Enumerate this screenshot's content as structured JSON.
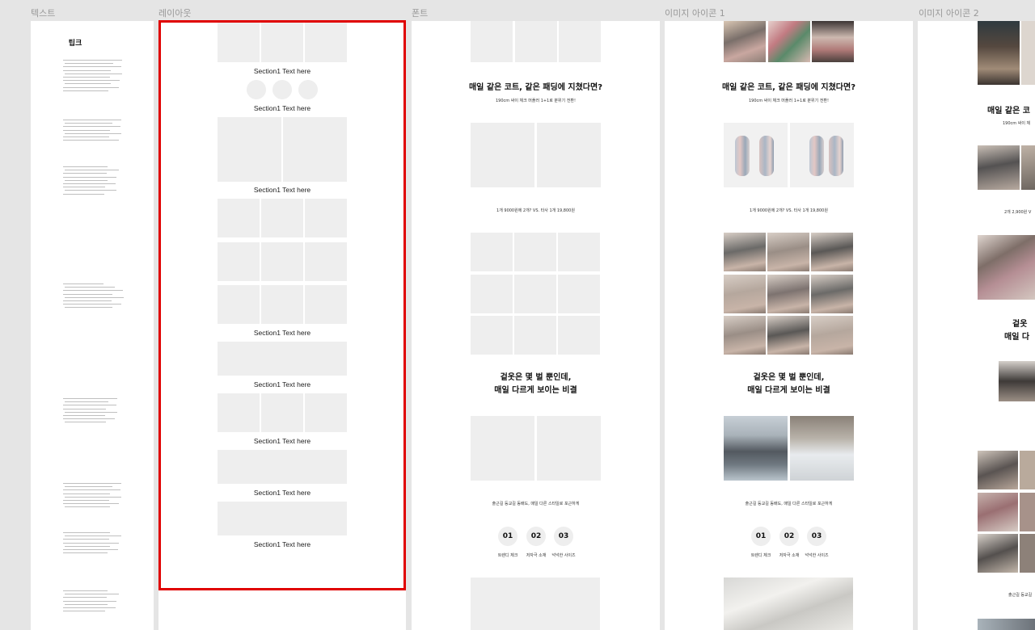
{
  "frames": {
    "text": "텍스트",
    "layout": "레이아웃",
    "font": "폰트",
    "image_icon_1": "이미지 아이콘 1",
    "image_icon_2": "이미지 아이콘 2"
  },
  "text_frame": {
    "title": "팁크"
  },
  "layout_frame": {
    "section_label": "Section1 Text here"
  },
  "font_frame": {
    "heading1": "매일 같은 코트, 같은 패딩에 지쳤다면?",
    "sub1": "190cm 싸이 체크 머플러 1+1로 분위기 전환!",
    "price_line": "1개 9000원에 2개?   VS.   타사 1개 19,800원",
    "heading2_line1": "겉옷은 몇 벌 뿐인데,",
    "heading2_line2": "매일 다르게 보이는 비결",
    "sub2": "출근길 등교길 동배도, 매일 다른 스타일로 포근하게",
    "steps": [
      {
        "num": "01",
        "label": "트렌디 체크"
      },
      {
        "num": "02",
        "label": "저자극 소재"
      },
      {
        "num": "03",
        "label": "넉넉한 사이즈"
      }
    ]
  },
  "image2_frame": {
    "heading_partial": "매일 같은 코",
    "sub_partial": "190cm 싸이 체",
    "price_partial": "2개 2,900원  V",
    "heading2_partial_1": "겉옷",
    "heading2_partial_2": "매일 다",
    "bottom_partial": "출근길 등교길"
  },
  "colors": {
    "selection": "#e00000",
    "placeholder": "#eeeeee",
    "canvas": "#e5e5e5"
  }
}
